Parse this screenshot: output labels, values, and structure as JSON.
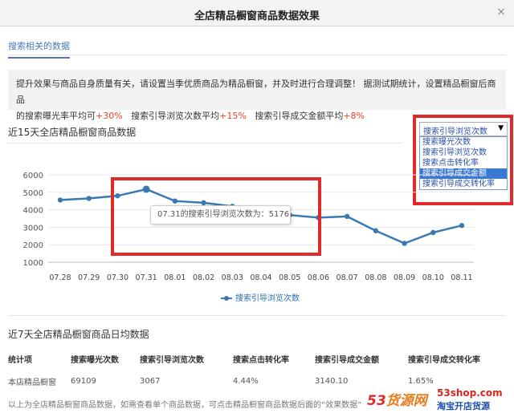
{
  "dialog": {
    "title": "全店精品橱窗商品数据效果",
    "close_label": "×"
  },
  "tab": {
    "label": "搜索相关的数据"
  },
  "info": {
    "line1": "提升效果与商品自身质量有关，请设置当季优质商品为精品橱窗，并及时进行合理调整！ 据测试期统计，设置精品橱窗后商品",
    "line2_a": "的搜索曝光率平均可",
    "line2_b": "+30%",
    "line2_c": "   搜索引导浏览次数平均",
    "line2_d": "+15%",
    "line2_e": "   搜索引导成交金额平均",
    "line2_f": "+8%"
  },
  "chart_section": {
    "title": "近15天全店精品橱窗商品数据"
  },
  "metric_select": {
    "selected": "搜索引导浏览次数",
    "options": [
      "搜索曝光次数",
      "搜索引导浏览次数",
      "搜索点击转化率",
      "搜索引导成交金额",
      "搜索引导成交转化率"
    ],
    "highlighted_index": 3
  },
  "tooltip": {
    "text": "07.31的搜索引导浏览次数为：5176"
  },
  "chart_data": {
    "type": "line",
    "categories": [
      "07.28",
      "07.29",
      "07.30",
      "07.31",
      "08.01",
      "08.02",
      "08.03",
      "08.04",
      "08.05",
      "08.06",
      "08.07",
      "08.08",
      "08.09",
      "08.10",
      "08.11"
    ],
    "series": [
      {
        "name": "搜索引导浏览次数",
        "values": [
          4560,
          4650,
          4800,
          5176,
          4500,
          4400,
          4200,
          3900,
          3700,
          3550,
          3620,
          2800,
          2080,
          2700,
          3100
        ]
      }
    ],
    "yticks": [
      1000,
      2000,
      3000,
      4000,
      5000,
      6000
    ],
    "ylim": [
      1000,
      6000
    ],
    "color": "#3a7ab3",
    "grid": true
  },
  "table_section": {
    "title": "近7天全店精品橱窗商品日均数据",
    "headers": [
      "统计项",
      "搜索曝光次数",
      "搜索引导浏览次数",
      "搜索点击转化率",
      "搜索引导成交金额",
      "搜索引导成交转化率"
    ],
    "row": [
      "本店精品橱窗",
      "69109",
      "3067",
      "4.44%",
      "3140.10",
      "1.65%"
    ]
  },
  "footer": {
    "note": "以上为全店精品橱窗商品数据，如需查看单个商品数据，可点击精品橱窗商品数据后面的“效果数据”"
  },
  "watermark": {
    "logo_a": "53",
    "logo_b": "货源网",
    "url": "53shop.com",
    "slogan": "淘宝开店货源"
  }
}
